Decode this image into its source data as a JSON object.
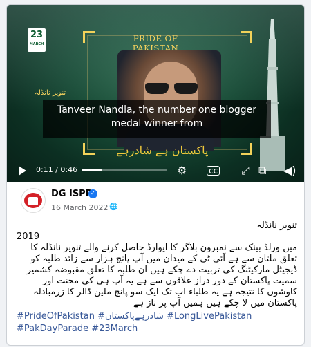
{
  "video": {
    "banner_title": "PRIDE OF PAKISTAN",
    "logo_text": "23",
    "logo_sub": "MARCH",
    "caption_line1": "Tanveer Nandla, the number one blogger",
    "caption_line2": "medal winner from",
    "urdu_overlay": "پاکستان ہے شادرہے",
    "side_text": "تنویر نانڈلہ",
    "time": "0:11 / 0:46",
    "progress": 0.24
  },
  "post": {
    "author": "DG ISPR",
    "verified_icon": "verified-badge-icon",
    "date": "16 March 2022",
    "privacy_icon": "globe-icon",
    "text_title": "تنویر نانڈلہ",
    "year": "2019",
    "paragraph": "میں ورلڈ بینک سے نمبرون بلاگر کا ایوارڈ حاصل کرنے والے تنویر نانڈلہ کا تعلق ملتان سے ہے آئی ٹی کے میدان میں آپ پانچ ہزار سے زائد طلبہ کو ڈیجیٹل مارکیٹنگ کی تربیت دے چکے ہیں ان طلبہ کا تعلق مقبوضہ کشمیر سمیت پاکستان کے دور دراز علاقوں سے ہے یہ آپ ہی کی محنت اور کاوشوں کا نتیجہ ہے یہ طلباء اب تک ایک سو پانچ ملین ڈالر کا زرمبادلہ پاکستان میں لا چکے ہیں ہمیں آپ پر ناز ہے",
    "hashtags_line1": "#PrideOfPakistan #شادرہےپاکستان #LongLivePakistan",
    "hashtags_line2": "#PakDayParade #23March"
  },
  "accent": "#f5d25e",
  "link_color": "#385898"
}
